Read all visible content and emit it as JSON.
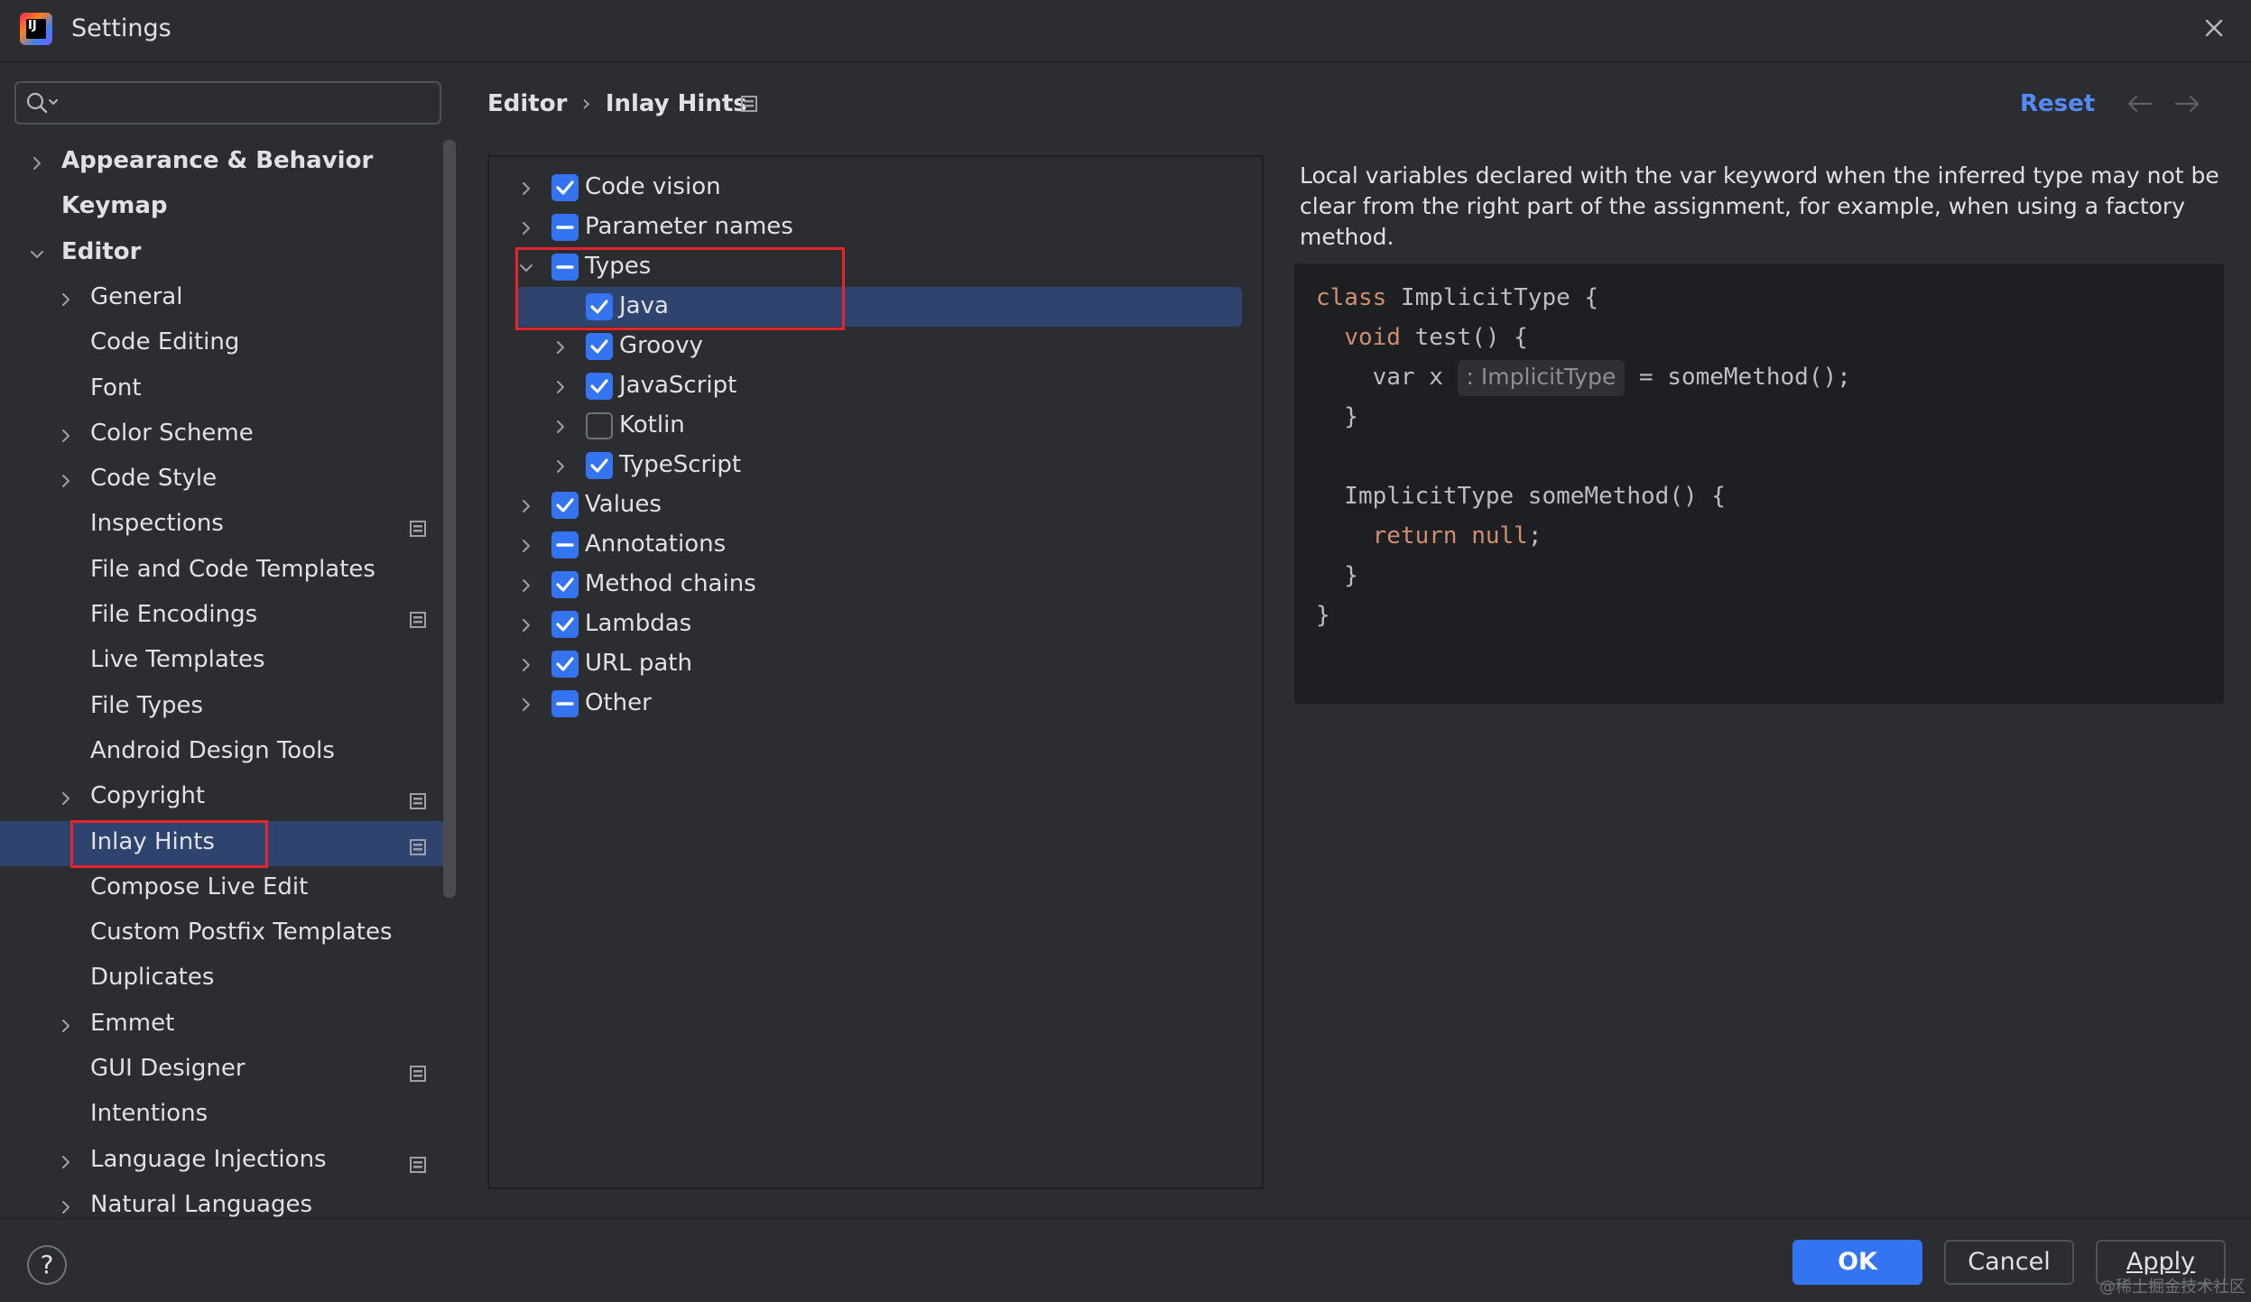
{
  "window": {
    "title": "Settings"
  },
  "search": {
    "value": "",
    "placeholder": ""
  },
  "sidebar": {
    "items": [
      {
        "label": "Appearance & Behavior",
        "level": 0,
        "expandable": true,
        "expanded": false,
        "bold": true,
        "pinned": false,
        "selected": false
      },
      {
        "label": "Keymap",
        "level": 0,
        "expandable": false,
        "expanded": false,
        "bold": true,
        "pinned": false,
        "selected": false
      },
      {
        "label": "Editor",
        "level": 0,
        "expandable": true,
        "expanded": true,
        "bold": true,
        "pinned": false,
        "selected": false
      },
      {
        "label": "General",
        "level": 1,
        "expandable": true,
        "expanded": false,
        "bold": false,
        "pinned": false,
        "selected": false
      },
      {
        "label": "Code Editing",
        "level": 1,
        "expandable": false,
        "expanded": false,
        "bold": false,
        "pinned": false,
        "selected": false
      },
      {
        "label": "Font",
        "level": 1,
        "expandable": false,
        "expanded": false,
        "bold": false,
        "pinned": false,
        "selected": false
      },
      {
        "label": "Color Scheme",
        "level": 1,
        "expandable": true,
        "expanded": false,
        "bold": false,
        "pinned": false,
        "selected": false
      },
      {
        "label": "Code Style",
        "level": 1,
        "expandable": true,
        "expanded": false,
        "bold": false,
        "pinned": false,
        "selected": false
      },
      {
        "label": "Inspections",
        "level": 1,
        "expandable": false,
        "expanded": false,
        "bold": false,
        "pinned": true,
        "selected": false
      },
      {
        "label": "File and Code Templates",
        "level": 1,
        "expandable": false,
        "expanded": false,
        "bold": false,
        "pinned": false,
        "selected": false
      },
      {
        "label": "File Encodings",
        "level": 1,
        "expandable": false,
        "expanded": false,
        "bold": false,
        "pinned": true,
        "selected": false
      },
      {
        "label": "Live Templates",
        "level": 1,
        "expandable": false,
        "expanded": false,
        "bold": false,
        "pinned": false,
        "selected": false
      },
      {
        "label": "File Types",
        "level": 1,
        "expandable": false,
        "expanded": false,
        "bold": false,
        "pinned": false,
        "selected": false
      },
      {
        "label": "Android Design Tools",
        "level": 1,
        "expandable": false,
        "expanded": false,
        "bold": false,
        "pinned": false,
        "selected": false
      },
      {
        "label": "Copyright",
        "level": 1,
        "expandable": true,
        "expanded": false,
        "bold": false,
        "pinned": true,
        "selected": false
      },
      {
        "label": "Inlay Hints",
        "level": 1,
        "expandable": false,
        "expanded": false,
        "bold": false,
        "pinned": true,
        "selected": true
      },
      {
        "label": "Compose Live Edit",
        "level": 1,
        "expandable": false,
        "expanded": false,
        "bold": false,
        "pinned": false,
        "selected": false
      },
      {
        "label": "Custom Postfix Templates",
        "level": 1,
        "expandable": false,
        "expanded": false,
        "bold": false,
        "pinned": false,
        "selected": false
      },
      {
        "label": "Duplicates",
        "level": 1,
        "expandable": false,
        "expanded": false,
        "bold": false,
        "pinned": false,
        "selected": false
      },
      {
        "label": "Emmet",
        "level": 1,
        "expandable": true,
        "expanded": false,
        "bold": false,
        "pinned": false,
        "selected": false
      },
      {
        "label": "GUI Designer",
        "level": 1,
        "expandable": false,
        "expanded": false,
        "bold": false,
        "pinned": true,
        "selected": false
      },
      {
        "label": "Intentions",
        "level": 1,
        "expandable": false,
        "expanded": false,
        "bold": false,
        "pinned": false,
        "selected": false
      },
      {
        "label": "Language Injections",
        "level": 1,
        "expandable": true,
        "expanded": false,
        "bold": false,
        "pinned": true,
        "selected": false
      },
      {
        "label": "Natural Languages",
        "level": 1,
        "expandable": true,
        "expanded": false,
        "bold": false,
        "pinned": false,
        "selected": false
      }
    ]
  },
  "header": {
    "breadcrumb": [
      "Editor",
      "Inlay Hints"
    ],
    "breadcrumb_sep": "›",
    "reset_label": "Reset"
  },
  "hints_tree": {
    "items": [
      {
        "label": "Code vision",
        "level": 0,
        "state": "checked",
        "expandable": true,
        "expanded": false,
        "selected": false
      },
      {
        "label": "Parameter names",
        "level": 0,
        "state": "partial",
        "expandable": true,
        "expanded": false,
        "selected": false
      },
      {
        "label": "Types",
        "level": 0,
        "state": "partial",
        "expandable": true,
        "expanded": true,
        "selected": false
      },
      {
        "label": "Java",
        "level": 1,
        "state": "checked",
        "expandable": false,
        "expanded": false,
        "selected": true
      },
      {
        "label": "Groovy",
        "level": 1,
        "state": "checked",
        "expandable": true,
        "expanded": false,
        "selected": false
      },
      {
        "label": "JavaScript",
        "level": 1,
        "state": "checked",
        "expandable": true,
        "expanded": false,
        "selected": false
      },
      {
        "label": "Kotlin",
        "level": 1,
        "state": "unchecked",
        "expandable": true,
        "expanded": false,
        "selected": false
      },
      {
        "label": "TypeScript",
        "level": 1,
        "state": "checked",
        "expandable": true,
        "expanded": false,
        "selected": false
      },
      {
        "label": "Values",
        "level": 0,
        "state": "checked",
        "expandable": true,
        "expanded": false,
        "selected": false
      },
      {
        "label": "Annotations",
        "level": 0,
        "state": "partial",
        "expandable": true,
        "expanded": false,
        "selected": false
      },
      {
        "label": "Method chains",
        "level": 0,
        "state": "checked",
        "expandable": true,
        "expanded": false,
        "selected": false
      },
      {
        "label": "Lambdas",
        "level": 0,
        "state": "checked",
        "expandable": true,
        "expanded": false,
        "selected": false
      },
      {
        "label": "URL path",
        "level": 0,
        "state": "checked",
        "expandable": true,
        "expanded": false,
        "selected": false
      },
      {
        "label": "Other",
        "level": 0,
        "state": "partial",
        "expandable": true,
        "expanded": false,
        "selected": false
      }
    ]
  },
  "description": "Local variables declared with the var keyword when the inferred type may not be clear from the right part of the assignment, for example, when using a factory method.",
  "code_preview": {
    "lines": [
      [
        {
          "t": "class ",
          "k": true
        },
        {
          "t": "ImplicitType {",
          "k": false
        }
      ],
      [
        {
          "t": "  ",
          "k": false
        },
        {
          "t": "void ",
          "k": true
        },
        {
          "t": "test() {",
          "k": false
        }
      ],
      [
        {
          "t": "    var x ",
          "k": false
        },
        {
          "t": ": ImplicitType",
          "hint": true
        },
        {
          "t": " = someMethod();",
          "k": false
        }
      ],
      [
        {
          "t": "  }",
          "k": false
        }
      ],
      [
        {
          "t": "",
          "k": false
        }
      ],
      [
        {
          "t": "  ImplicitType someMethod() {",
          "k": false
        }
      ],
      [
        {
          "t": "    ",
          "k": false
        },
        {
          "t": "return null",
          "k": true
        },
        {
          "t": ";",
          "k": false
        }
      ],
      [
        {
          "t": "  }",
          "k": false
        }
      ],
      [
        {
          "t": "}",
          "k": false
        }
      ]
    ]
  },
  "footer": {
    "help_label": "?",
    "ok_label": "OK",
    "cancel_label": "Cancel",
    "apply_label": "Apply"
  },
  "watermark": "@稀土掘金技术社区",
  "colors": {
    "background": "#2b2d30",
    "accent": "#3574f0",
    "selection": "#2e436e",
    "link": "#548af7",
    "highlight_box": "#e5242c",
    "keyword": "#cf8e6d"
  },
  "icons": {
    "app": "intellij-idea-logo",
    "close": "close-icon",
    "search": "search-icon",
    "pin": "pinned-settings-icon",
    "back": "arrow-left-icon",
    "forward": "arrow-right-icon"
  }
}
